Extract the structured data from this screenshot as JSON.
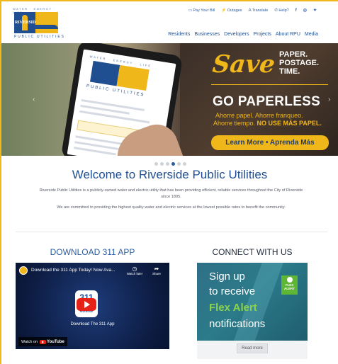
{
  "logo": {
    "tagline": "WATER · ENERGY · LIFE",
    "city": "RIVERSIDE",
    "name": "PUBLIC UTILITIES"
  },
  "utility_nav": [
    {
      "icon": "credit-card-icon",
      "glyph": "▭",
      "label": "Pay Your Bill"
    },
    {
      "icon": "lightning-icon",
      "glyph": "⚡",
      "label": "Outages"
    },
    {
      "icon": "translate-icon",
      "glyph": "A",
      "label": "Translate"
    },
    {
      "icon": "phone-icon",
      "glyph": "✆",
      "label": "Help?"
    }
  ],
  "social": [
    {
      "icon": "facebook-icon",
      "glyph": "f"
    },
    {
      "icon": "instagram-icon",
      "glyph": "◎"
    },
    {
      "icon": "twitter-icon",
      "glyph": "✦"
    }
  ],
  "main_nav": [
    "Residents",
    "Businesses",
    "Developers",
    "Projects",
    "About RPU",
    "Media"
  ],
  "hero": {
    "save": "Save",
    "paper_lines": [
      "PAPER.",
      "POSTAGE.",
      "TIME."
    ],
    "headline": "GO PAPERLESS",
    "spanish_line1": "Ahorre papel. Ahorre franqueo.",
    "spanish_line2_a": "Ahorre tiempo.",
    "spanish_line2_b": "NO USE MÁS PAPEL.",
    "cta": "Learn More • Aprenda Más",
    "prev_arrow": "‹",
    "next_arrow": "›",
    "slides": 6,
    "active_slide": 4
  },
  "welcome": {
    "title": "Welcome to Riverside Public Utilities",
    "paragraph1": "Riverside Public Utilities is a publicly-owned water and electric utility that has been providing efficient, reliable services throughout the City of Riverside since 1895.",
    "paragraph2": "We are committed to providing the highest quality water and electric services at the lowest possible rates to benefit the community."
  },
  "download": {
    "heading": "DOWNLOAD 311 APP",
    "video_title": "Download the 311 App Today! Now Ava...",
    "watch_later": "Watch later",
    "share": "Share",
    "app_number": "311",
    "app_city": "RIVERSIDE",
    "caption": "Download The 311 App",
    "watch_on": "Watch on",
    "youtube": "YouTube"
  },
  "connect": {
    "heading": "CONNECT WITH US",
    "line1": "Sign up",
    "line2": "to receive",
    "line3": "Flex Alert",
    "line4": "notifications",
    "badge": "FLEX ALERT",
    "read_more": "Read more"
  },
  "colors": {
    "brand_blue": "#1f4f91",
    "brand_gold": "#f0b71a",
    "flex_green": "#8cd24b"
  }
}
